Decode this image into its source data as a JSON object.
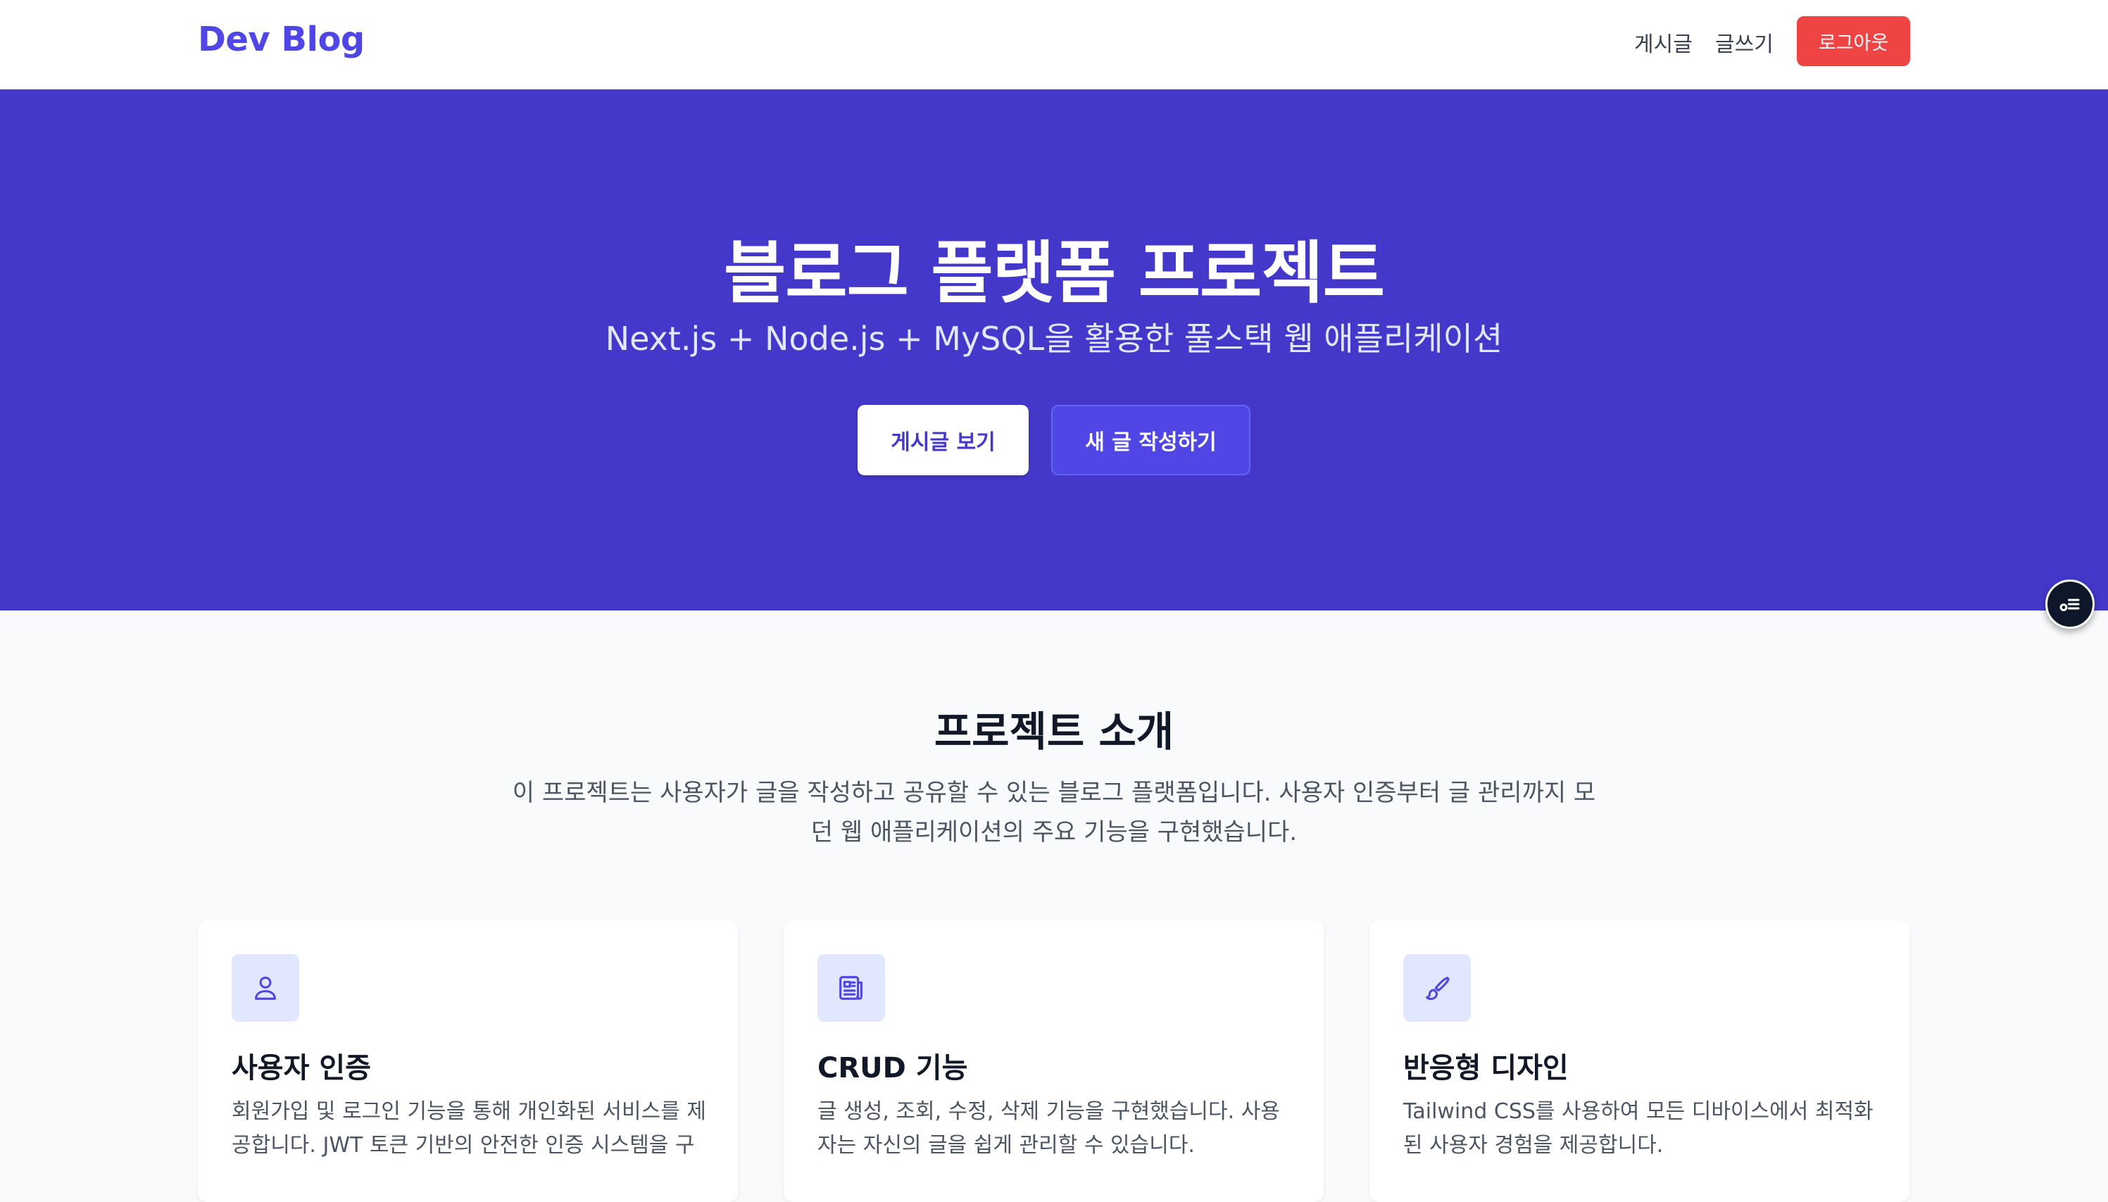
{
  "header": {
    "logo": "Dev Blog",
    "nav": {
      "posts": "게시글",
      "write": "글쓰기"
    },
    "logout_label": "로그아웃"
  },
  "hero": {
    "title": "블로그 플랫폼 프로젝트",
    "subtitle": "Next.js + Node.js + MySQL을 활용한 풀스택 웹 애플리케이션",
    "view_posts_label": "게시글 보기",
    "new_post_label": "새 글 작성하기"
  },
  "intro": {
    "title": "프로젝트 소개",
    "description": "이 프로젝트는 사용자가 글을 작성하고 공유할 수 있는 블로그 플랫폼입니다. 사용자 인증부터 글 관리까지 모던 웹 애플리케이션의 주요 기능을 구현했습니다."
  },
  "features": [
    {
      "icon": "user-icon",
      "title": "사용자 인증",
      "description": "회원가입 및 로그인 기능을 통해 개인화된 서비스를 제공합니다. JWT 토큰 기반의 안전한 인증 시스템을 구"
    },
    {
      "icon": "newspaper-icon",
      "title": "CRUD 기능",
      "description": "글 생성, 조회, 수정, 삭제 기능을 구현했습니다. 사용자는 자신의 글을 쉽게 관리할 수 있습니다."
    },
    {
      "icon": "paintbrush-icon",
      "title": "반응형 디자인",
      "description": "Tailwind CSS를 사용하여 모든 디바이스에서 최적화된 사용자 경험을 제공합니다."
    }
  ],
  "colors": {
    "brand": "#4f46e5",
    "hero_bg": "#4338ca",
    "logout": "#ef4444",
    "icon_bg": "#e0e7ff"
  }
}
